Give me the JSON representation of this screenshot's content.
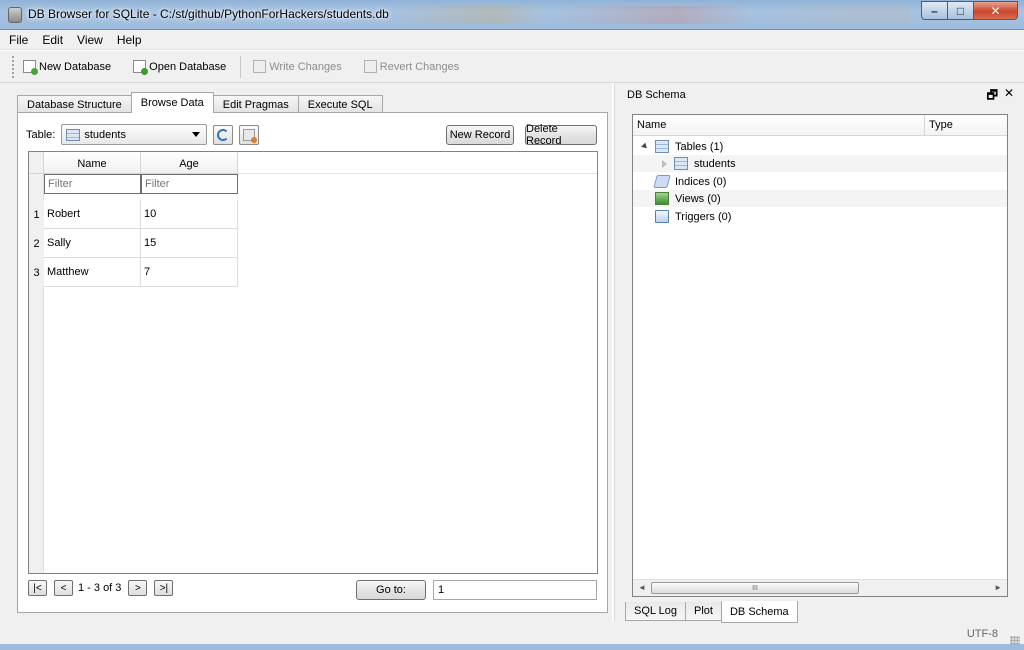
{
  "window": {
    "title": "DB Browser for SQLite - C:/st/github/PythonForHackers/students.db",
    "minimize_glyph": "–",
    "maximize_glyph": "□",
    "close_glyph": "✕"
  },
  "menu": [
    "File",
    "Edit",
    "View",
    "Help"
  ],
  "toolbar": {
    "new_database": "New Database",
    "open_database": "Open Database",
    "write_changes": "Write Changes",
    "revert_changes": "Revert Changes"
  },
  "tabs": [
    "Database Structure",
    "Browse Data",
    "Edit Pragmas",
    "Execute SQL"
  ],
  "active_tab": "Browse Data",
  "browse": {
    "table_label": "Table:",
    "selected_table": "students",
    "new_record": "New Record",
    "delete_record": "Delete Record",
    "columns": [
      "Name",
      "Age"
    ],
    "filter_placeholder": "Filter",
    "rows": [
      {
        "num": "1",
        "name": "Robert",
        "age": "10"
      },
      {
        "num": "2",
        "name": "Sally",
        "age": "15"
      },
      {
        "num": "3",
        "name": "Matthew",
        "age": "7"
      }
    ],
    "nav": {
      "first": "|<",
      "prev": "<",
      "range": "1 - 3 of 3",
      "next": ">",
      "last": ">|",
      "goto_label": "Go to:",
      "goto_value": "1"
    }
  },
  "schema": {
    "title": "DB Schema",
    "dock_float_glyph": "🗗",
    "dock_close_glyph": "✕",
    "col_name": "Name",
    "col_type": "Type",
    "tables": "Tables (1)",
    "table_students": "students",
    "indices": "Indices (0)",
    "views": "Views (0)",
    "triggers": "Triggers (0)",
    "scroll_left": "◄",
    "scroll_right": "►",
    "scroll_thumb": "III"
  },
  "bottom_tabs": [
    "SQL Log",
    "Plot",
    "DB Schema"
  ],
  "active_bottom_tab": "DB Schema",
  "status": {
    "encoding": "UTF-8"
  }
}
